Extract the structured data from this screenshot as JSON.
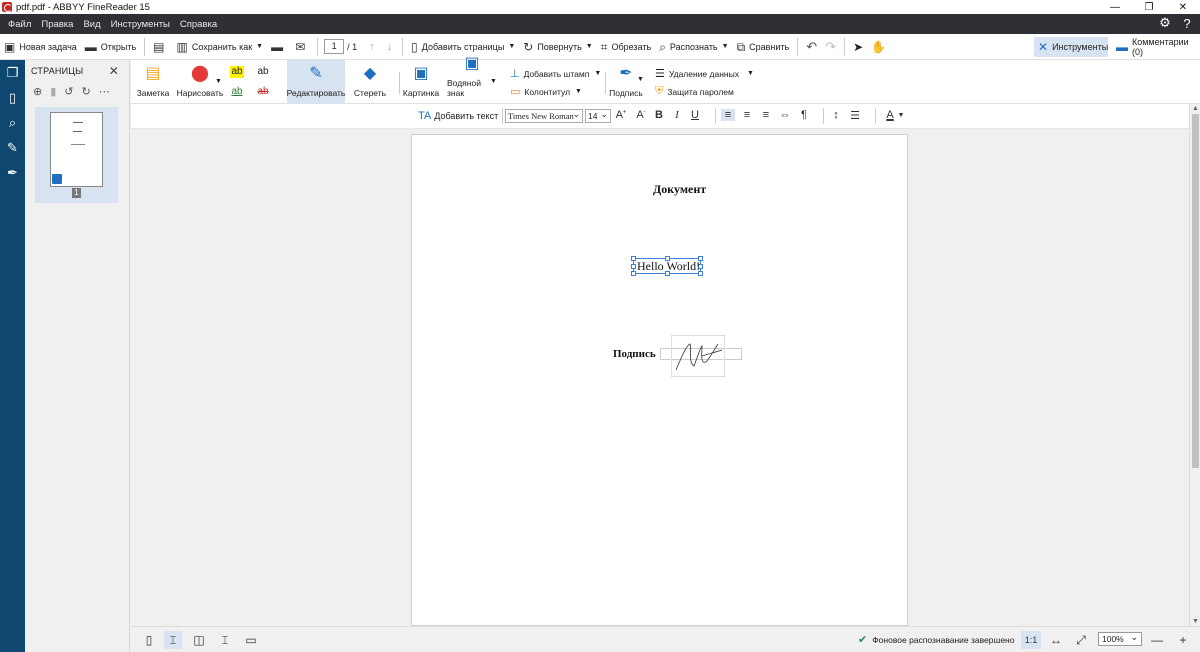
{
  "window": {
    "title": "pdf.pdf - ABBYY FineReader 15",
    "minimize": "—",
    "restore": "❐",
    "close": "✕"
  },
  "menu": {
    "items": [
      "Файл",
      "Правка",
      "Вид",
      "Инструменты",
      "Справка"
    ]
  },
  "toolbar": {
    "new_task": "Новая задача",
    "open": "Открыть",
    "save_as": "Сохранить как",
    "page_current": "1",
    "page_total": "/ 1",
    "add_pages": "Добавить страницы",
    "rotate": "Повернуть",
    "crop": "Обрезать",
    "recognize": "Распознать",
    "compare": "Сравнить",
    "tools": "Инструменты",
    "comments": "Комментарии (0)"
  },
  "pages_panel": {
    "title": "СТРАНИЦЫ",
    "page_number": "1"
  },
  "ribbon": {
    "note": "Заметка",
    "draw": "Нарисовать",
    "edit": "Редактировать",
    "erase": "Стереть",
    "image": "Картинка",
    "watermark": "Водяной знак",
    "add_stamp": "Добавить штамп",
    "header_footer": "Колонтитул",
    "signature": "Подпись",
    "remove_data": "Удаление данных",
    "password_protect": "Защита паролем",
    "hl_ab": "ab"
  },
  "format": {
    "add_text": "Добавить текст",
    "font": "Times New Roman",
    "size": "14"
  },
  "document": {
    "title": "Документ",
    "hello": "Hello World!",
    "signature_label": "Подпись"
  },
  "status": {
    "message": "Фоновое распознавание завершено",
    "ratio": "1:1",
    "zoom": "100%"
  },
  "colors": {
    "menubar": "#2f3035",
    "leftstrip": "#0e4770",
    "accent": "#1f6fc1",
    "active": "#d7e3f1"
  }
}
